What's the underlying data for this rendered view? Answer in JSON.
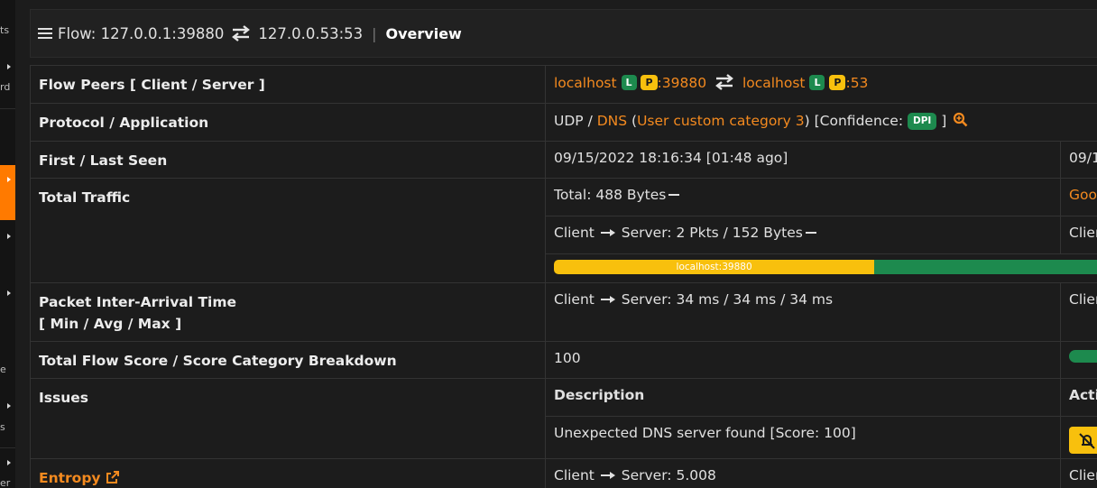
{
  "sidebar": {
    "fragments": [
      "ts",
      "rd",
      "e",
      "s",
      "er"
    ]
  },
  "header": {
    "flow_label": "Flow: 127.0.0.1:39880",
    "server_addr": "127.0.0.53:53",
    "separator": "|",
    "section": "Overview"
  },
  "rows": {
    "peers": {
      "label": "Flow Peers [ Client / Server ]",
      "client_host": "localhost",
      "client_port": ":39880",
      "server_host": "localhost",
      "server_port": ":53",
      "badge_l": "L",
      "badge_p": "P"
    },
    "protocol": {
      "label": "Protocol / Application",
      "proto": "UDP",
      "slash": " / ",
      "app": "DNS",
      "open_paren": " (",
      "category": "User custom category 3",
      "close_paren": ")",
      "confidence_prefix": " [Confidence: ",
      "confidence": "DPI",
      "confidence_suffix": " ]"
    },
    "seen": {
      "label": "First / Last Seen",
      "first": "09/15/2022 18:16:34 [01:48 ago]",
      "last_partial": "09/1"
    },
    "traffic": {
      "label": "Total Traffic",
      "total": "Total: 488 Bytes",
      "right_partial": "Goo",
      "c2s_client": "Client",
      "c2s_rest": "Server: 2 Pkts / 152 Bytes",
      "c2s_right_partial": "Clien",
      "bar_label": "localhost:39880",
      "bar_client_fraction": 0.59
    },
    "iat": {
      "label_line1": "Packet Inter-Arrival Time",
      "label_line2": "[ Min / Avg / Max ]",
      "client": "Client",
      "rest": "Server: 34 ms / 34 ms / 34 ms",
      "right_partial": "Clien"
    },
    "score": {
      "label": "Total Flow Score / Score Category Breakdown",
      "value": "100"
    },
    "issues": {
      "label": "Issues",
      "desc_header": "Description",
      "actions_header_partial": "Acti",
      "desc": "Unexpected DNS server found [Score: 100]"
    },
    "entropy": {
      "label": "Entropy",
      "client": "Client",
      "rest": "Server: 5.008",
      "right_partial": "Clien"
    }
  },
  "colors": {
    "accent_orange": "#f48a1f",
    "badge_green": "#1d8a4e",
    "badge_yellow": "#f8c00d",
    "background": "#1c1c1c"
  }
}
